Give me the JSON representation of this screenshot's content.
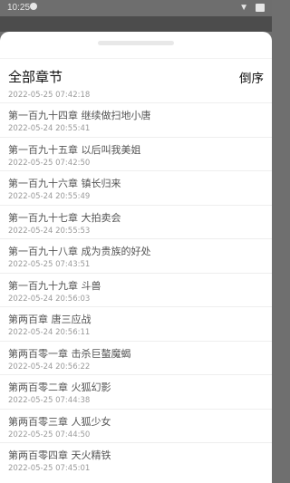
{
  "status_bar": {
    "time": "10:25"
  },
  "header": {
    "title": "全部章节",
    "sort_label": "倒序"
  },
  "first_date": "2022-05-25 07:42:18",
  "chapters": [
    {
      "title": "第一百九十四章 继续做扫地小唐",
      "date": "2022-05-24 20:55:41"
    },
    {
      "title": "第一百九十五章 以后叫我美姐",
      "date": "2022-05-25 07:42:50"
    },
    {
      "title": "第一百九十六章 镇长归来",
      "date": "2022-05-24 20:55:49"
    },
    {
      "title": "第一百九十七章 大拍卖会",
      "date": "2022-05-24 20:55:53"
    },
    {
      "title": "第一百九十八章 成为贵族的好处",
      "date": "2022-05-25 07:43:51"
    },
    {
      "title": "第一百九十九章 斗兽",
      "date": "2022-05-24 20:56:03"
    },
    {
      "title": "第两百章 唐三应战",
      "date": "2022-05-24 20:56:11"
    },
    {
      "title": "第两百零一章 击杀巨螯魔蝎",
      "date": "2022-05-24 20:56:22"
    },
    {
      "title": "第两百零二章 火狐幻影",
      "date": "2022-05-25 07:44:38"
    },
    {
      "title": "第两百零三章 人狐少女",
      "date": "2022-05-25 07:44:50"
    },
    {
      "title": "第两百零四章 天火精铁",
      "date": "2022-05-25 07:45:01"
    }
  ]
}
